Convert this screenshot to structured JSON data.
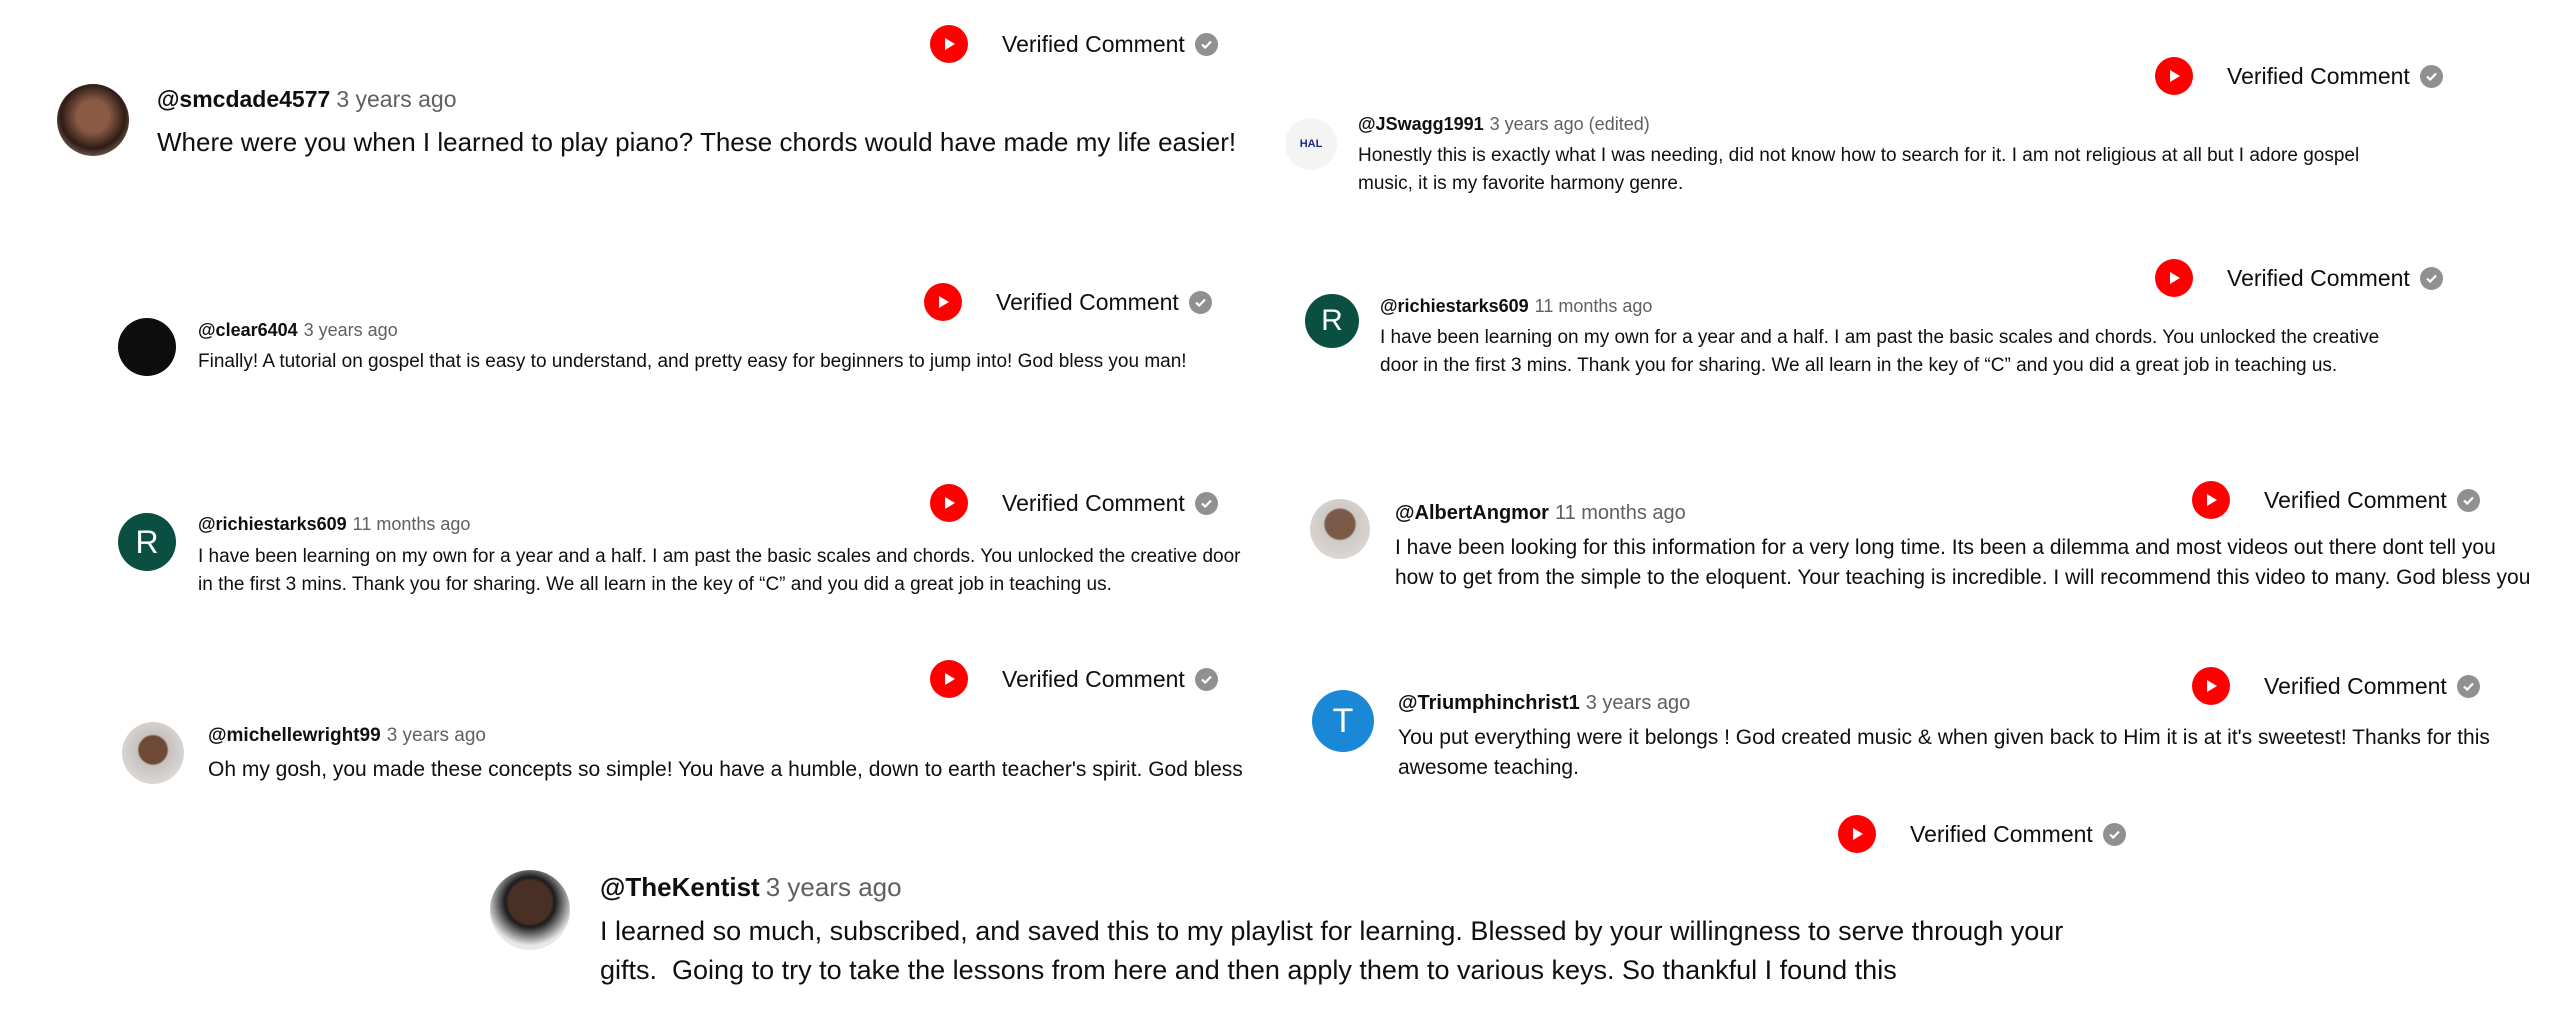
{
  "badge": {
    "label": "Verified Comment",
    "icon": "youtube-play-icon",
    "check_icon": "check-circle-icon"
  },
  "colors": {
    "youtube_red": "#ff0000",
    "check_gray": "#909090",
    "r_avatar": "#0b4f42",
    "t_avatar": "#1a88d6"
  },
  "comments": [
    {
      "handle": "@smcdade4577",
      "time": "3 years ago",
      "text": "Where were you when I learned to play piano? These chords would have made my life easier!"
    },
    {
      "handle": "@JSwagg1991",
      "time": "3 years ago (edited)",
      "text": "Honestly this is exactly what I was needing, did not know how to search for it. I am not religious at all but I adore gospel music, it is my favorite harmony genre.",
      "avatar_logo": "HAL"
    },
    {
      "handle": "@clear6404",
      "time": "3 years ago",
      "text": "Finally! A tutorial on gospel that is easy to understand, and pretty easy for beginners to jump into! God bless you man!"
    },
    {
      "handle": "@richiestarks609",
      "time": "11 months ago",
      "text": "I have been learning on my own for a year and a half. I am past the basic scales and chords. You unlocked the creative door in the first 3 mins. Thank you for sharing. We all learn in the key of “C” and you did a great job in teaching us.",
      "avatar_letter": "R"
    },
    {
      "handle": "@richiestarks609",
      "time": "11 months ago",
      "text": "I have been learning on my own for a year and a half. I am past the basic scales and chords. You unlocked the creative door in the first 3 mins. Thank you for sharing. We all learn in the key of “C” and you did a great job in teaching us.",
      "avatar_letter": "R"
    },
    {
      "handle": "@AlbertAngmor",
      "time": "11 months ago",
      "text": "I have been looking for this information for a very long time. Its been a dilemma and most videos out there dont tell you how to get from the simple to the eloquent. Your teaching is incredible. I will recommend this video to many. God bless you"
    },
    {
      "handle": "@michellewright99",
      "time": "3 years ago",
      "text": "Oh my gosh, you made these concepts so simple! You have a humble, down to earth teacher's spirit. God bless"
    },
    {
      "handle": "@Triumphinchrist1",
      "time": "3 years ago",
      "text": "You put everything were it belongs ! God created music & when given back to Him it is at it's sweetest! Thanks for this awesome teaching.",
      "avatar_letter": "T"
    },
    {
      "handle": "@TheKentist",
      "time": "3 years ago",
      "text": "I learned so much, subscribed, and saved this to my playlist for learning. Blessed by your willingness to serve through your gifts.  Going to try to take the lessons from here and then apply them to various keys. So thankful I found this"
    }
  ]
}
